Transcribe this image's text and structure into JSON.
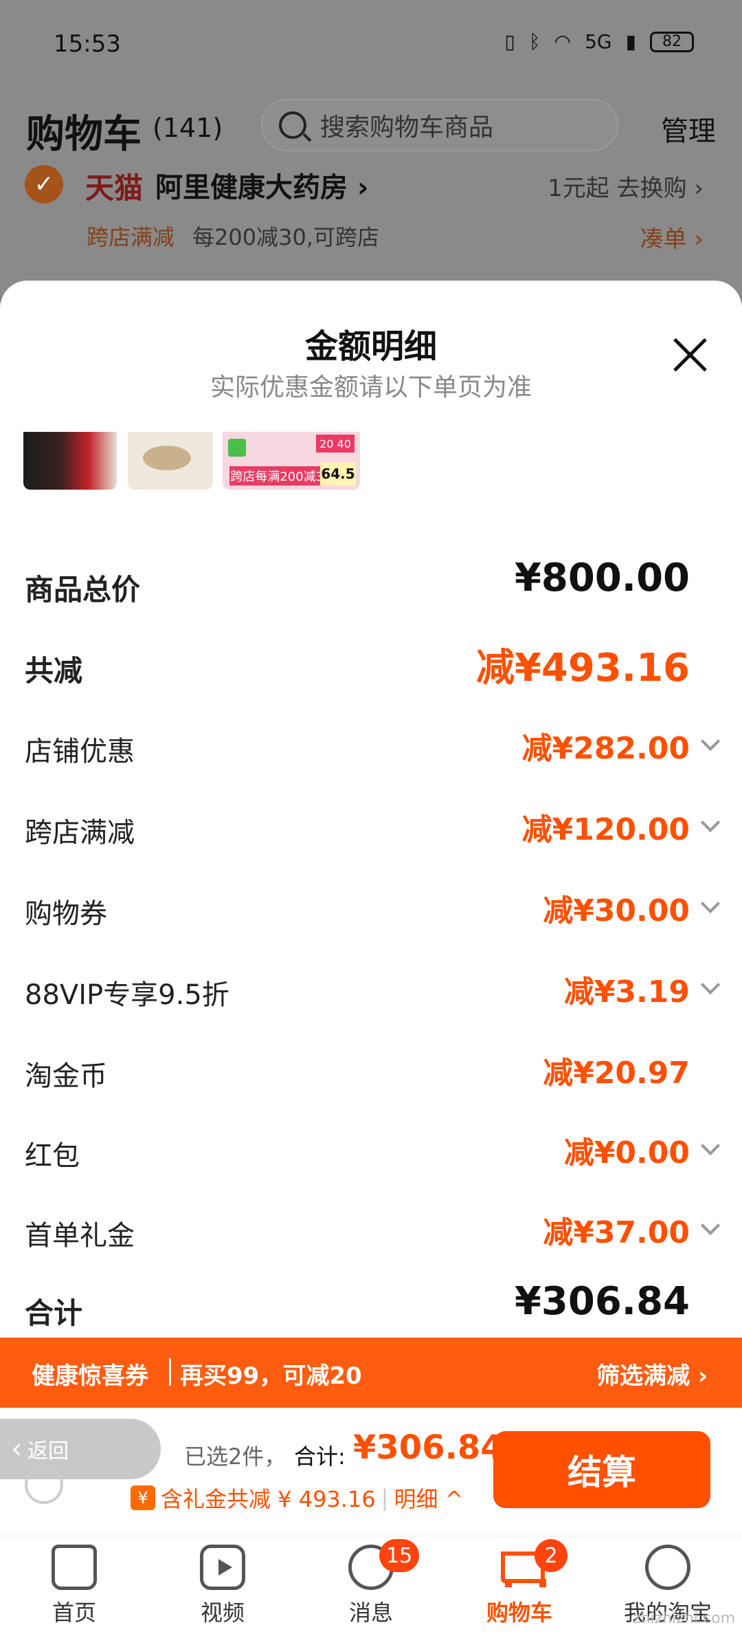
{
  "status": {
    "time": "15:53",
    "network": "5G",
    "battery": "82"
  },
  "cart": {
    "title": "购物车",
    "count": "(141)",
    "search_placeholder": "搜索购物车商品",
    "manage": "管理"
  },
  "store": {
    "brand": "天猫",
    "name": "阿里健康大药房 ›",
    "exchange": "1元起 去换购 ›",
    "promo_tag": "跨店满减",
    "promo_desc": "每200减30,可跨店",
    "promo_add": "凑单 ›"
  },
  "sheet": {
    "title": "金额明细",
    "subtitle": "实际优惠金额请以下单页为准",
    "thumb_promo": "跨店每满200减30",
    "thumb_price": "64.5",
    "thumb_badge": "20  40",
    "rows": [
      {
        "label": "商品总价",
        "value": "¥800.00"
      },
      {
        "label": "共减",
        "value": "减¥493.16"
      },
      {
        "label": "店铺优惠",
        "value": "减¥282.00"
      },
      {
        "label": "跨店满减",
        "value": "减¥120.00"
      },
      {
        "label": "购物券",
        "value": "减¥30.00"
      },
      {
        "label": "88VIP专享9.5折",
        "value": "减¥3.19"
      },
      {
        "label": "淘金币",
        "value": "减¥20.97"
      },
      {
        "label": "红包",
        "value": "减¥0.00"
      },
      {
        "label": "首单礼金",
        "value": "减¥37.00"
      }
    ],
    "total_label": "合计",
    "total_value": "¥306.84"
  },
  "banner": {
    "title": "健康惊喜券",
    "offer": "再买99，可减20",
    "filter": "筛选满减 ›"
  },
  "checkout": {
    "back": "返回",
    "selected": "已选2件，",
    "total_label": "合计:",
    "total_value": "¥306.84",
    "discount": "含礼金共减 ¥ 493.16",
    "detail": "明细 ^",
    "gift_icon_text": "¥",
    "button": "结算"
  },
  "tabs": [
    {
      "label": "首页",
      "icon": "home-icon"
    },
    {
      "label": "视频",
      "icon": "video-icon"
    },
    {
      "label": "消息",
      "icon": "message-icon",
      "badge": "15"
    },
    {
      "label": "购物车",
      "icon": "cart-icon",
      "badge": "2",
      "active": true
    },
    {
      "label": "我的淘宝",
      "icon": "profile-icon"
    }
  ],
  "watermark": "zhizhizhi.com",
  "colors": {
    "accent": "#ff5000",
    "banner": "#ff5c10",
    "dim_overlay": "#8a8a8a"
  }
}
